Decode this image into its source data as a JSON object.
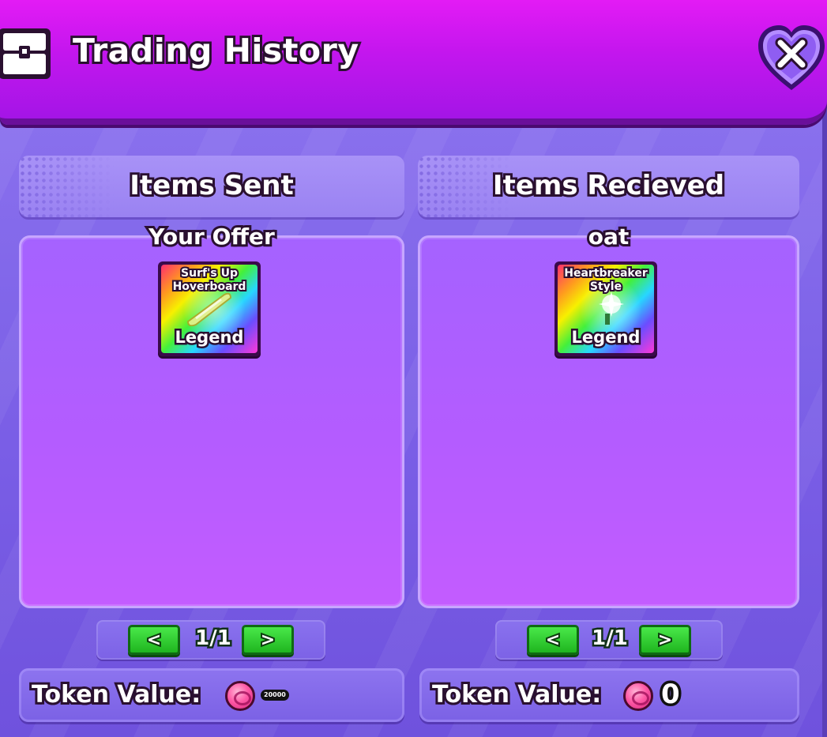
{
  "window": {
    "title": "Trading History",
    "header_icon": "chest-icon",
    "close_icon": "close-heart-icon",
    "colors": {
      "header": "#c316ee",
      "panel": "#b45cff",
      "background": "#7a5ee6",
      "pager_button": "#1fb51f"
    }
  },
  "left": {
    "heading": "Items Sent",
    "owner": "Your Offer",
    "items": [
      {
        "name_line1": "Surf's Up",
        "name_line2": "Hoverboard",
        "rarity": "Legend",
        "art": "hoverboard-icon"
      }
    ],
    "pager": {
      "prev": "<",
      "count": "1/1",
      "next": ">"
    },
    "token_label": "Token Value:",
    "token_value": "20000",
    "token_icon": "token-coin-icon"
  },
  "right": {
    "heading": "Items Recieved",
    "owner": "oat",
    "items": [
      {
        "name_line1": "Heartbreaker",
        "name_line2": "Style",
        "rarity": "Legend",
        "art": "sparkle-style-icon"
      }
    ],
    "pager": {
      "prev": "<",
      "count": "1/1",
      "next": ">"
    },
    "token_label": "Token Value:",
    "token_value": "0",
    "token_icon": "token-coin-icon"
  }
}
